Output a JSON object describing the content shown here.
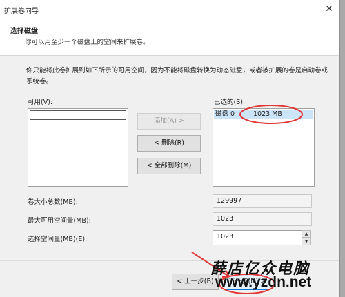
{
  "window": {
    "title": "扩展卷向导",
    "close_glyph": "✕"
  },
  "header": {
    "title": "选择磁盘",
    "subtitle": "你可以用至少一个磁盘上的空间来扩展卷。"
  },
  "description": "你只能将此卷扩展到如下所示的可用空间，因为不能将磁盘转换为动态磁盘，或者被扩展的卷是启动卷或系统卷。",
  "available": {
    "label": "可用(V):",
    "items": [
      ""
    ]
  },
  "selected": {
    "label": "已选的(S):",
    "items": [
      {
        "disk": "磁盘 0",
        "size": "1023 MB"
      }
    ]
  },
  "buttons": {
    "add": "添加(A) >",
    "remove": "< 删除(R)",
    "remove_all": "< 全部删除(M)",
    "back": "< 上一步(B)",
    "next": "下一步(N) >"
  },
  "fields": {
    "total_label": "卷大小总数(MB):",
    "total_value": "129997",
    "max_label": "最大可用空间量(MB):",
    "max_value": "1023",
    "select_label": "选择空间量(MB)(E):",
    "select_value": "1023"
  },
  "spinner": {
    "up": "▲",
    "down": "▼"
  },
  "watermark": {
    "text": "薛店亿众电脑",
    "url": "www.yzdn.net"
  },
  "colors": {
    "selection": "#cce4f7",
    "annotation_red": "#e23636",
    "header_bg": "#ffffff",
    "dialog_bg": "#f0f0f0"
  }
}
